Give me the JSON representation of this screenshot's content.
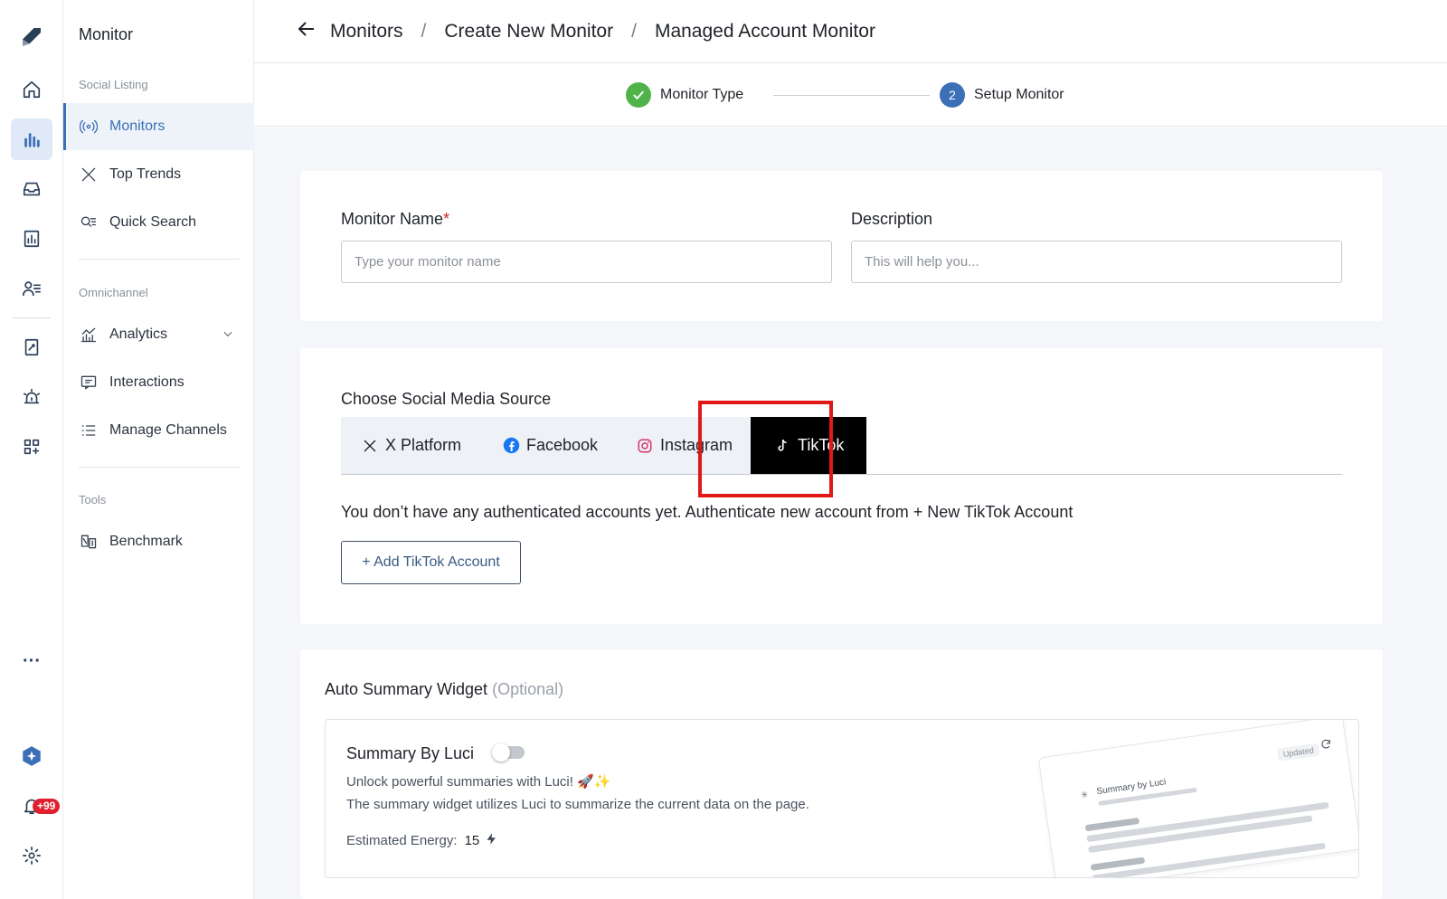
{
  "rail": {
    "items": [
      "logo-icon",
      "home-icon",
      "monitor-chart-icon",
      "inbox-icon",
      "report-icon",
      "contacts-icon",
      "notes-icon",
      "alert-icon",
      "apps-icon"
    ],
    "more": "···",
    "notifications_badge": "+99"
  },
  "subnav": {
    "title": "Monitor",
    "sections": {
      "social": "Social Listing",
      "omni": "Omnichannel",
      "tools": "Tools"
    },
    "items": [
      {
        "label": "Monitors",
        "icon": "radar-icon"
      },
      {
        "label": "Top Trends",
        "icon": "x-logo-icon"
      },
      {
        "label": "Quick Search",
        "icon": "search-list-icon"
      },
      {
        "label": "Analytics",
        "icon": "analytics-icon"
      },
      {
        "label": "Interactions",
        "icon": "interactions-icon"
      },
      {
        "label": "Manage Channels",
        "icon": "list-icon"
      },
      {
        "label": "Benchmark",
        "icon": "benchmark-icon"
      }
    ]
  },
  "breadcrumb": {
    "items": [
      "Monitors",
      "Create New Monitor",
      "Managed Account Monitor"
    ],
    "separator": "/"
  },
  "stepper": {
    "steps": [
      {
        "label": "Monitor Type",
        "state": "done"
      },
      {
        "label": "Setup Monitor",
        "number": "2",
        "state": "current"
      }
    ]
  },
  "form": {
    "monitor_name": {
      "label": "Monitor Name",
      "required": "*",
      "placeholder": "Type your monitor name"
    },
    "description": {
      "label": "Description",
      "placeholder": "This will help you..."
    }
  },
  "source": {
    "label": "Choose Social Media Source",
    "tabs": [
      "X Platform",
      "Facebook",
      "Instagram",
      "TikTok"
    ],
    "selected": "TikTok",
    "message": "You don’t have any authenticated accounts yet. Authenticate new account from + New TikTok Account",
    "add_button": "+ Add TikTok Account"
  },
  "widget": {
    "title": "Auto Summary Widget",
    "optional": "(Optional)",
    "summary_title": "Summary By Luci",
    "line1": "Unlock powerful summaries with Luci! 🚀✨",
    "line2": "The summary widget utilizes Luci to summarize the current data on the page.",
    "energy_label": "Estimated Energy:",
    "energy_value": "15",
    "preview_title": "Summary by Luci",
    "preview_badge": "Updated"
  },
  "colors": {
    "accent": "#3b6fb6",
    "success": "#4fb34a",
    "highlight": "#e01818",
    "badge": "#e0202f"
  }
}
